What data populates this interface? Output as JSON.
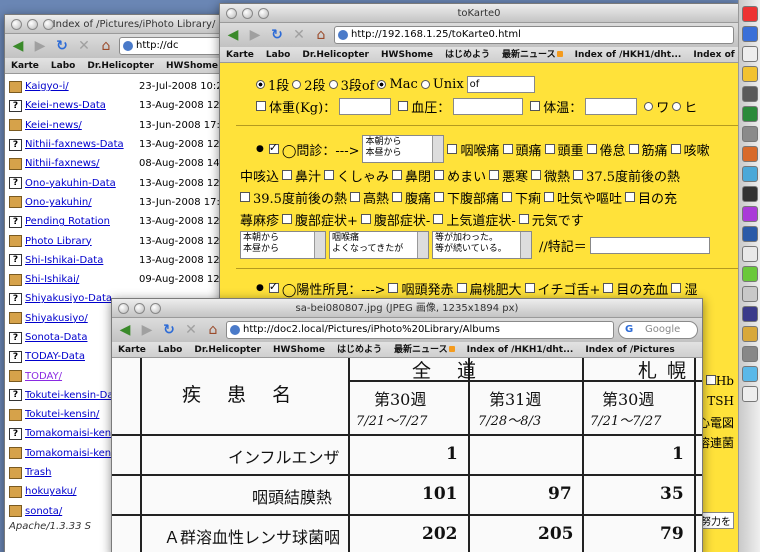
{
  "winA": {
    "title": "Index of /Pictures/iPhoto Library/",
    "url": "http://dc",
    "bookmarks": [
      "Karte",
      "Labo",
      "Dr.Helicopter",
      "HWShome",
      "はじめ"
    ],
    "rows": [
      {
        "name": "Kaigyo-i/",
        "date": "23-Jul-2008 10:22",
        "type": "folder"
      },
      {
        "name": "Keiei-news-Data",
        "date": "13-Aug-2008 12:48",
        "type": "file"
      },
      {
        "name": "Keiei-news/",
        "date": "13-Jun-2008 17:05",
        "type": "folder"
      },
      {
        "name": "Nithii-faxnews-Data",
        "date": "13-Aug-2008 12:48",
        "type": "file"
      },
      {
        "name": "Nithii-faxnews/",
        "date": "08-Aug-2008 14:08",
        "type": "folder"
      },
      {
        "name": "Ono-yakuhin-Data",
        "date": "13-Aug-2008 12:48",
        "type": "file"
      },
      {
        "name": "Ono-yakuhin/",
        "date": "13-Jun-2008 17:35",
        "type": "folder"
      },
      {
        "name": "Pending Rotation",
        "date": "13-Aug-2008 12:48",
        "type": "file"
      },
      {
        "name": "Photo Library",
        "date": "13-Aug-2008 12:48",
        "type": "folder"
      },
      {
        "name": "Shi-Ishikai-Data",
        "date": "13-Aug-2008 12:48",
        "type": "file"
      },
      {
        "name": "Shi-Ishikai/",
        "date": "09-Aug-2008 12:28",
        "type": "folder"
      },
      {
        "name": "Shiyakusiyo-Data",
        "date": "",
        "type": "file"
      },
      {
        "name": "Shiyakusiyo/",
        "date": "",
        "type": "folder"
      },
      {
        "name": "Sonota-Data",
        "date": "",
        "type": "file"
      },
      {
        "name": "TODAY-Data",
        "date": "",
        "type": "file"
      },
      {
        "name": "TODAY/",
        "date": "",
        "type": "folder",
        "visited": true
      },
      {
        "name": "Tokutei-kensin-Data",
        "date": "",
        "type": "file"
      },
      {
        "name": "Tokutei-kensin/",
        "date": "",
        "type": "folder"
      },
      {
        "name": "Tomakomaisi-kenko",
        "date": "",
        "type": "file"
      },
      {
        "name": "Tomakomaisi-kenk",
        "date": "",
        "type": "folder"
      },
      {
        "name": "Trash",
        "date": "",
        "type": "folder"
      },
      {
        "name": "hokuyaku/",
        "date": "",
        "type": "folder"
      },
      {
        "name": "sonota/",
        "date": "",
        "type": "folder"
      }
    ],
    "footer": "Apache/1.3.33 S"
  },
  "winB": {
    "title": "toKarte0",
    "url": "http://192.168.1.25/toKarte0.html",
    "bookmarks": [
      "Karte",
      "Labo",
      "Dr.Helicopter",
      "HWShome",
      "はじめよう",
      "最新ニュース",
      "Index of /HKH1/dht...",
      "Index of /Pictures"
    ],
    "radio1": "1段",
    "radio2": "2段",
    "radio3": "3段of",
    "radio4": "Mac",
    "radio5": "Unix",
    "unix_value": "of",
    "weight_label": "体重(Kg)：",
    "bp_label": "血圧：",
    "temp_label": "体温：",
    "radio_wa": "ワ",
    "radio_hi": "ヒ",
    "monshin_label": "◯問診：--->",
    "sel1": [
      "本朝から",
      "本昼から"
    ],
    "sym_line1": [
      "咽喉痛",
      "頭痛",
      "頭重",
      "倦怠",
      "筋痛",
      "咳嗽"
    ],
    "sym_line2_lead": "中咳込",
    "sym_line2": [
      "鼻汁",
      "くしゃみ",
      "鼻閉",
      "めまい",
      "悪寒",
      "微熱",
      "37.5度前後の熱"
    ],
    "sym_line3": [
      "39.5度前後の熱",
      "高熱",
      "腹痛",
      "下腹部痛",
      "下痢",
      "吐気や嘔吐",
      "目の充"
    ],
    "sym_line4_lead": "蕁麻疹",
    "sym_line4": [
      "腹部症状+",
      "腹部症状-",
      "上気道症状-",
      "元気です"
    ],
    "sel2": [
      "本朝から",
      "本昼から"
    ],
    "sel3": [
      "咽喉痛",
      "よくなってきたが"
    ],
    "sel4": [
      "等が加わった。",
      "等が続いている。"
    ],
    "tokki_label": "//特記＝",
    "yosei_label": "◯陽性所見：--->",
    "find_line1": [
      "咽頭発赤",
      "扁桃肥大",
      "イチゴ舌+",
      "目の充血",
      "湿"
    ],
    "find_line2": [
      "収縮期雑音",
      "拡張期雑音",
      "胃部圧痛",
      "腹部過緊張",
      "皮膚緊張低下",
      "腹"
    ],
    "side_hb": "Hb",
    "side_tsh": "TSH",
    "side_ecg": "心電図",
    "side_strep": "溶連菌",
    "side_effort": "努力を"
  },
  "winC": {
    "title": "sa-bei080807.jpg (JPEG 画像, 1235x1894 px)",
    "url": "http://doc2.local/Pictures/iPhoto%20Library/Albums",
    "search_placeholder": "Google",
    "bookmarks": [
      "Karte",
      "Labo",
      "Dr.Helicopter",
      "HWShome",
      "はじめよう",
      "最新ニュース",
      "Index of /HKH1/dht...",
      "Index of /Pictures"
    ],
    "doc": {
      "header_all": "全 道",
      "header_sapporo": "札幌",
      "header_disease": "疾 患 名",
      "weeks": [
        "第30週",
        "第31週",
        "第30週"
      ],
      "ranges": [
        "7/21～7/27",
        "7/28～8/3",
        "7/21～7/27"
      ],
      "rows": [
        {
          "name": "インフルエンザ",
          "v1": "1",
          "v2": "",
          "v3": "1"
        },
        {
          "name": "咽頭結膜熱",
          "v1": "101",
          "v2": "97",
          "v3": "35"
        },
        {
          "name": "Ａ群溶血性レンサ球菌咽",
          "v1": "202",
          "v2": "205",
          "v3": "79"
        }
      ]
    }
  }
}
